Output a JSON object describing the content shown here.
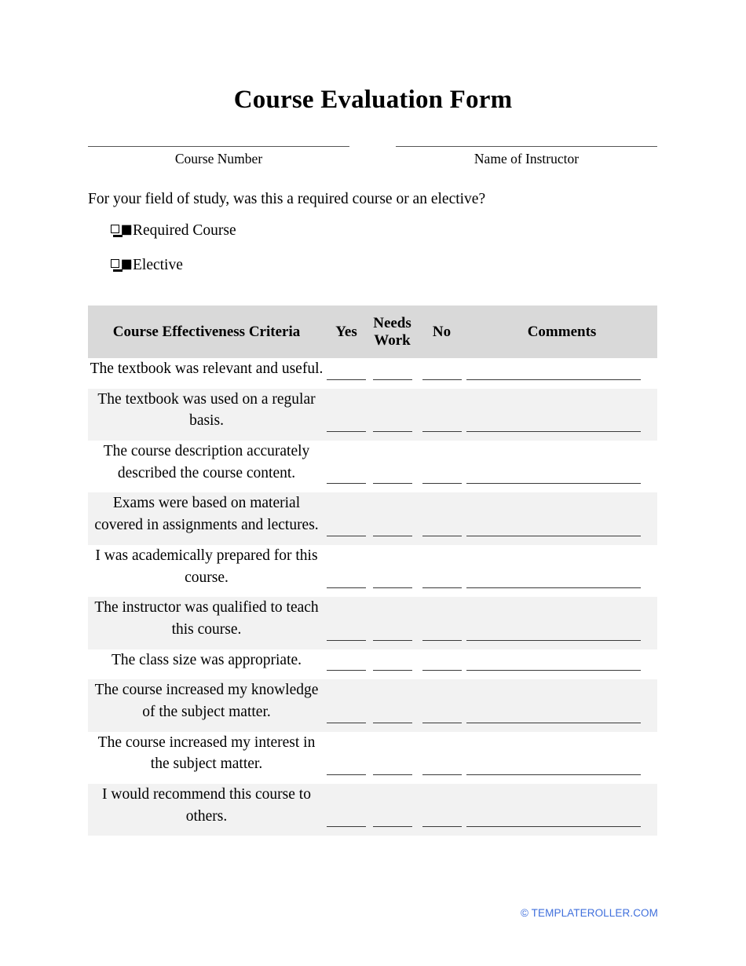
{
  "document": {
    "title": "Course Evaluation Form"
  },
  "identity": {
    "fields": [
      {
        "label": "Course Number",
        "value": ""
      },
      {
        "label": "Name of Instructor",
        "value": ""
      }
    ]
  },
  "question": {
    "prompt": "For your field of study, was this a required course or an elective?",
    "options": [
      {
        "label": "Required Course",
        "checkbox_icon": "checkbox-empty-icon",
        "checked": false
      },
      {
        "label": "Elective",
        "checkbox_icon": "checkbox-empty-icon",
        "checked": false
      }
    ]
  },
  "table": {
    "headers": {
      "criteria": "Course Effectiveness Criteria",
      "yes": "Yes",
      "needs_work": "Needs Work",
      "no": "No",
      "comments": "Comments"
    },
    "header_background": "#d9d9d9",
    "shaded_row_background": "#f2f2f2",
    "rows": [
      {
        "criteria": "The textbook was relevant and useful.",
        "yes": "",
        "needs_work": "",
        "no": "",
        "comments": ""
      },
      {
        "criteria": "The textbook was used on a regular basis.",
        "yes": "",
        "needs_work": "",
        "no": "",
        "comments": ""
      },
      {
        "criteria": "The course description accurately described the course content.",
        "yes": "",
        "needs_work": "",
        "no": "",
        "comments": ""
      },
      {
        "criteria": "Exams were based on material covered in assignments and lectures.",
        "yes": "",
        "needs_work": "",
        "no": "",
        "comments": ""
      },
      {
        "criteria": "I was academically prepared for this course.",
        "yes": "",
        "needs_work": "",
        "no": "",
        "comments": ""
      },
      {
        "criteria": "The instructor was qualified to teach this course.",
        "yes": "",
        "needs_work": "",
        "no": "",
        "comments": ""
      },
      {
        "criteria": "The class size was appropriate.",
        "yes": "",
        "needs_work": "",
        "no": "",
        "comments": ""
      },
      {
        "criteria": "The course increased my knowledge of the subject matter.",
        "yes": "",
        "needs_work": "",
        "no": "",
        "comments": ""
      },
      {
        "criteria": "The course increased my interest in the subject matter.",
        "yes": "",
        "needs_work": "",
        "no": "",
        "comments": ""
      },
      {
        "criteria": "I would recommend this course to others.",
        "yes": "",
        "needs_work": "",
        "no": "",
        "comments": ""
      }
    ]
  },
  "footer": {
    "watermark": "© TEMPLATEROLLER.COM",
    "color": "#3f6fdc"
  }
}
